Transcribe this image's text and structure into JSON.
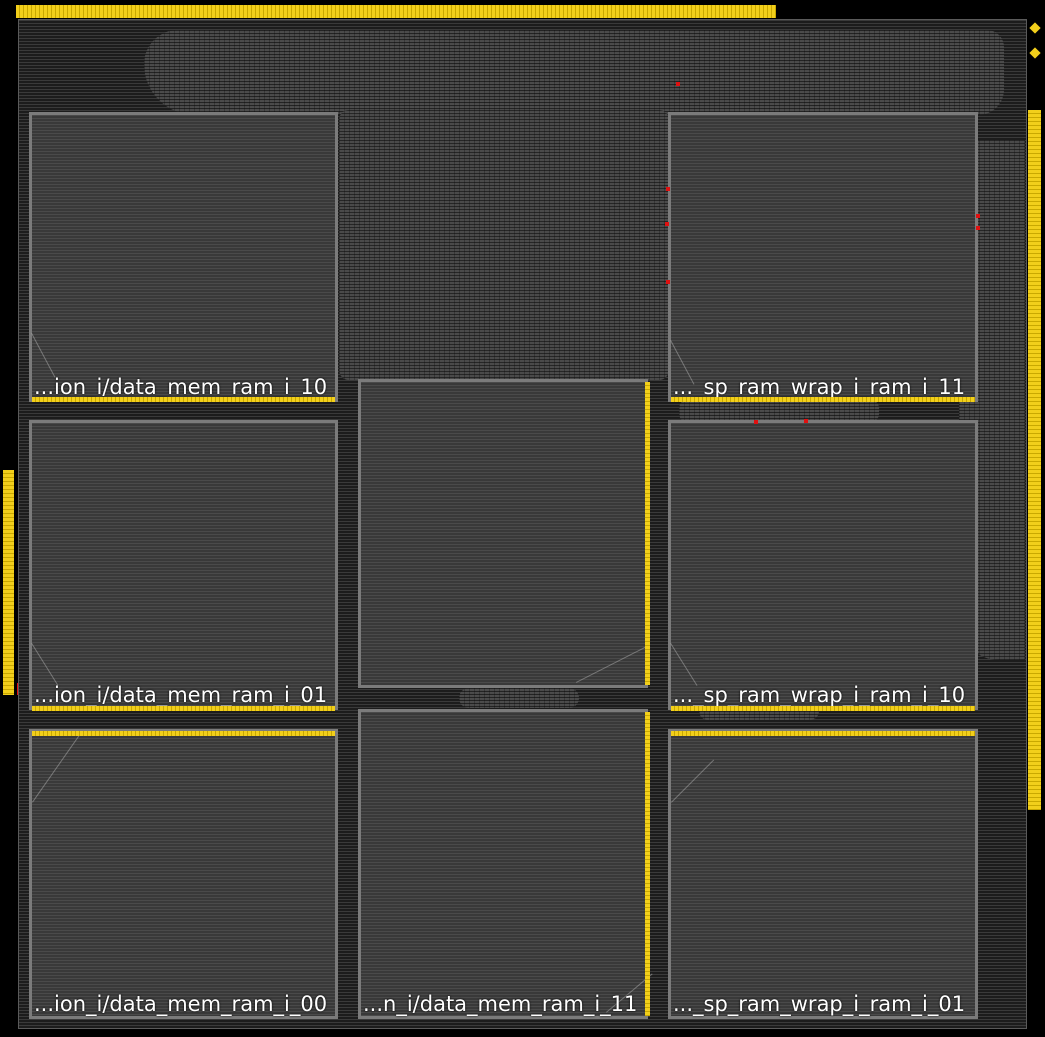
{
  "view": {
    "type": "device-floorplan",
    "colors": {
      "background": "#000000",
      "macro_border": "#7b7b7b",
      "pin_highlight": "#f2cf1b",
      "marker": "#e01010",
      "label": "#ffffff"
    }
  },
  "macros": [
    {
      "id": "ram-10-left",
      "label": "...ion_i/data_mem_ram_i_10"
    },
    {
      "id": "ram-11-right",
      "label": "..._sp_ram_wrap_i_ram_i_11"
    },
    {
      "id": "ram-01-left",
      "label": "...ion_i/data_mem_ram_i_01"
    },
    {
      "id": "ram-center",
      "label": ""
    },
    {
      "id": "ram-10-right",
      "label": "..._sp_ram_wrap_i_ram_i_10"
    },
    {
      "id": "ram-00-left",
      "label": "...ion_i/data_mem_ram_i_00"
    },
    {
      "id": "ram-11-center",
      "label": "...n_i/data_mem_ram_i_11"
    },
    {
      "id": "ram-01-right",
      "label": "..._sp_ram_wrap_i_ram_i_01"
    }
  ]
}
